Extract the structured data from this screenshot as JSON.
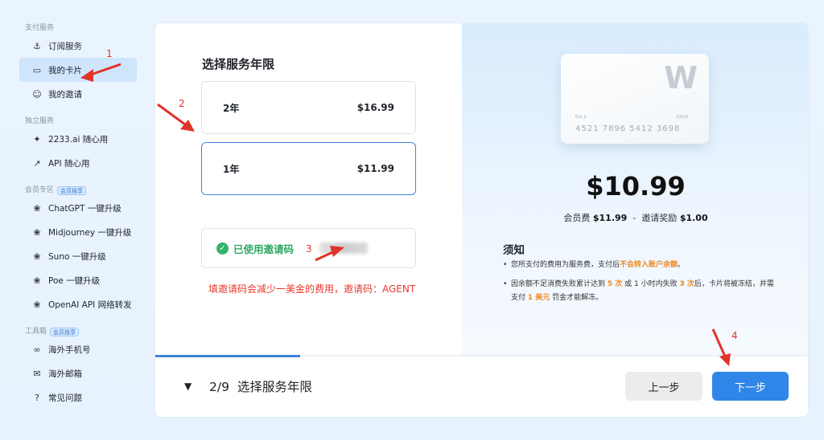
{
  "sidebar": {
    "sections": [
      {
        "title": "支付服务",
        "tag": "",
        "items": [
          {
            "label": "订阅服务",
            "icon": "subscription-icon"
          },
          {
            "label": "我的卡片",
            "icon": "card-icon"
          },
          {
            "label": "我的邀请",
            "icon": "invite-icon"
          }
        ]
      },
      {
        "title": "独立服务",
        "tag": "",
        "items": [
          {
            "label": "2233.ai 随心用",
            "icon": "sparkle-icon"
          },
          {
            "label": "API 随心用",
            "icon": "api-icon"
          }
        ]
      },
      {
        "title": "会员专区",
        "tag": "会员独享",
        "items": [
          {
            "label": "ChatGPT 一键升级",
            "icon": "openai-icon"
          },
          {
            "label": "Midjourney 一键升级",
            "icon": "openai-icon"
          },
          {
            "label": "Suno 一键升级",
            "icon": "openai-icon"
          },
          {
            "label": "Poe 一键升级",
            "icon": "openai-icon"
          },
          {
            "label": "OpenAI API 网络转发",
            "icon": "openai-icon"
          }
        ]
      },
      {
        "title": "工具箱",
        "tag": "会员独享",
        "items": [
          {
            "label": "海外手机号",
            "icon": "link-icon"
          },
          {
            "label": "海外邮箱",
            "icon": "mail-icon"
          },
          {
            "label": "常见问题",
            "icon": "help-icon"
          }
        ]
      }
    ]
  },
  "main": {
    "title": "选择服务年限",
    "options": [
      {
        "label": "2年",
        "price": "$16.99"
      },
      {
        "label": "1年",
        "price": "$11.99"
      }
    ],
    "promo_label": "已使用邀请码",
    "promo_hint": "填邀请码会减少一美金的费用，邀请码：AGENT"
  },
  "card": {
    "logo": "W",
    "holder": "Ella Ji",
    "expiry": "03/29",
    "number": "4521  7896  5412  3698"
  },
  "pricing": {
    "total": "$10.99",
    "fee_label": "会员费",
    "fee": "$11.99",
    "sep": "-",
    "reward_label": "邀请奖励",
    "reward": "$1.00"
  },
  "notice": {
    "title": "须知",
    "l1_a": "您所支付的费用为服务费，支付后",
    "l1_b": "不会转入账户余额",
    "l1_c": "。",
    "l2_a": "因余额不足消费失败累计达到",
    "l2_b": "5 次",
    "l2_c": "或 1 小时内失败",
    "l2_d": "3 次",
    "l2_e": "后，卡片将被冻结，并需支付",
    "l2_f": "1 美元",
    "l2_g": "罚金才能解冻。"
  },
  "footer": {
    "step": "2/9",
    "step_title": "选择服务年限",
    "prev": "上一步",
    "next": "下一步"
  },
  "annotations": [
    "1",
    "2",
    "3",
    "4"
  ],
  "colors": {
    "accent": "#2f86e8",
    "annotation": "#e0342b",
    "success": "#32b36b",
    "warning": "#f08a24"
  }
}
